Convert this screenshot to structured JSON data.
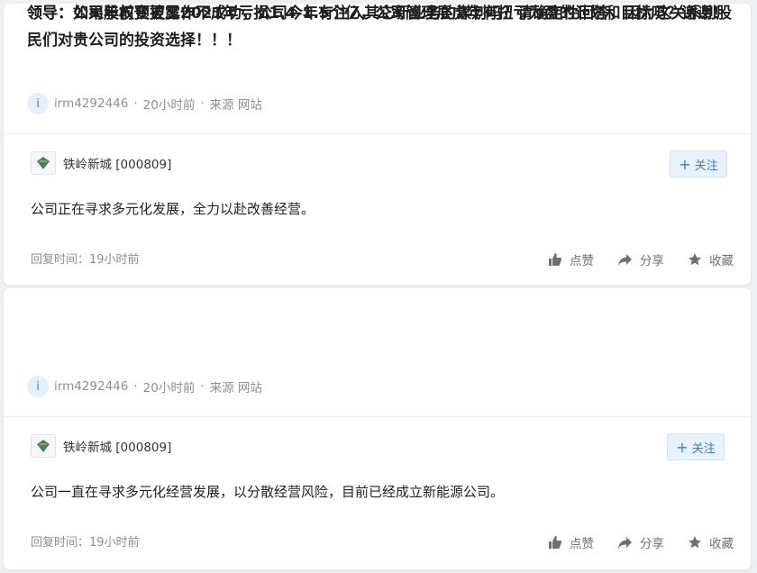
{
  "posts": [
    {
      "question": "领导：公司年前预披露2021年亏损1.4-1.5个亿，公司管理层虎年有扭亏为盈的计划和目标吗？谢谢！",
      "avatar_letter": "i",
      "user": "irm4292446",
      "time": "20小时前",
      "source": "来源 网站",
      "company": "铁岭新城 [000809]",
      "follow_label": "关注",
      "answer": "公司正在寻求多元化发展，全力以赴改善经营。",
      "reply_time": "回复时间：19小时前",
      "like_label": "点赞",
      "share_label": "分享",
      "fav_label": "收藏"
    },
    {
      "question": "领导：如果股权变更工作不成功，公司今年有注入其它新业务的谋划吗？请确定性回答，因为这关系到股民们对贵公司的投资选择！！！",
      "avatar_letter": "i",
      "user": "irm4292446",
      "time": "20小时前",
      "source": "来源 网站",
      "company": "铁岭新城 [000809]",
      "follow_label": "关注",
      "answer": "公司一直在寻求多元化经营发展，以分散经营风险，目前已经成立新能源公司。",
      "reply_time": "回复时间：19小时前",
      "like_label": "点赞",
      "share_label": "分享",
      "fav_label": "收藏"
    }
  ]
}
